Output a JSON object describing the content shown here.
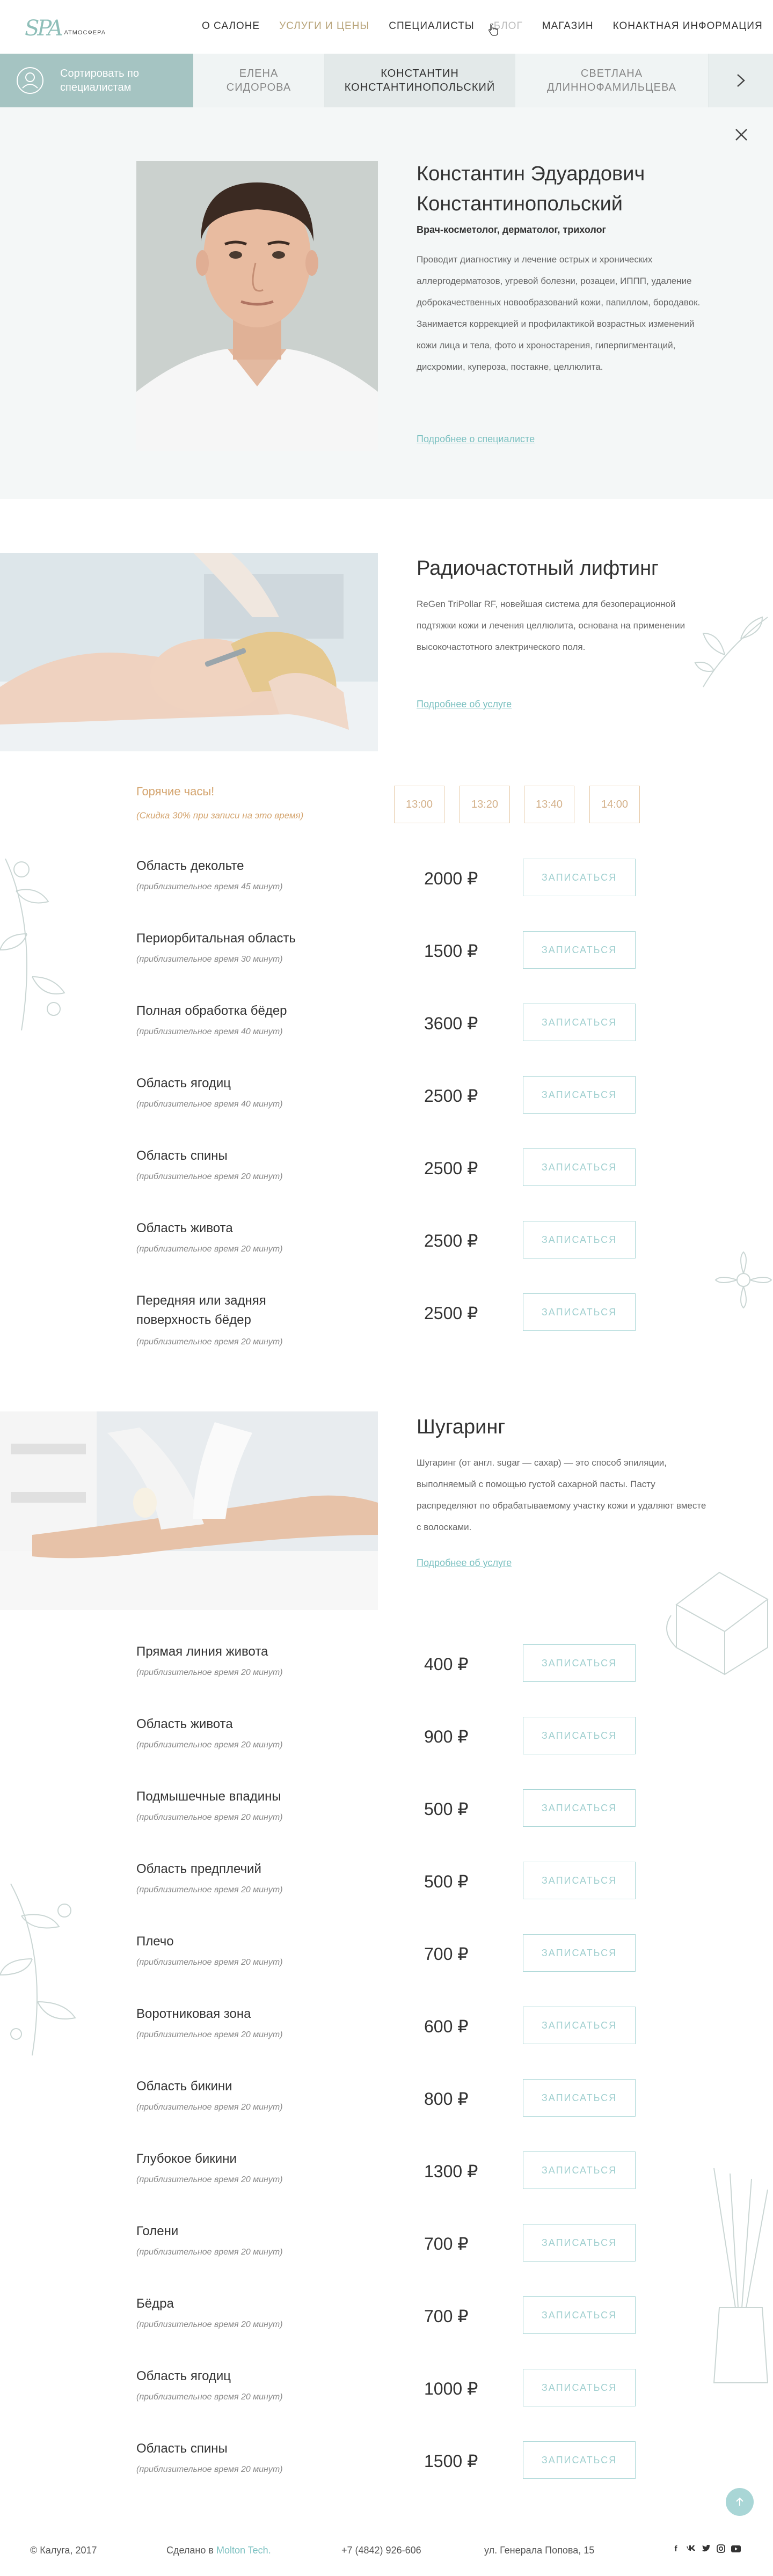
{
  "logo": {
    "mark": "SPA",
    "text": "АТМОСФЕРА"
  },
  "nav": [
    {
      "label": "О САЛОНЕ",
      "state": "normal"
    },
    {
      "label": "УСЛУГИ И ЦЕНЫ",
      "state": "active"
    },
    {
      "label": "СПЕЦИАЛИСТЫ",
      "state": "normal"
    },
    {
      "label": "БЛОГ",
      "state": "dim"
    },
    {
      "label": "МАГАЗИН",
      "state": "normal"
    },
    {
      "label": "КОНАКТНАЯ ИНФОРМАЦИЯ",
      "state": "normal"
    }
  ],
  "spec_bar": {
    "sort_label": "Сортировать по специалистам",
    "tabs": [
      "ЕЛЕНА СИДОРОВА",
      "КОНСТАНТИН КОНСТАНТИНОПОЛЬСКИЙ",
      "СВЕТЛАНА ДЛИННОФАМИЛЬЦЕВА"
    ],
    "active_tab": 1
  },
  "profile": {
    "name": "Константин Эдуардович Константинопольский",
    "role": "Врач-косметолог, дерматолог, трихолог",
    "description": "Проводит диагностику и лечение острых и хронических аллергодерматозов, угревой болезни, розацеи, ИППП, удаление доброкачественных новообразований кожи, папиллом, бородавок. Занимается коррекцией и профилактикой возрастных изменений кожи лица и тела, фото и хроностарения, гиперпигментаций, дисхромии, купероза, постакне, целлюлита.",
    "link": "Подробнее о специалисте"
  },
  "service1": {
    "title": "Радиочастотный  лифтинг",
    "description": "ReGen TriPollar RF, новейшая система для безоперационной подтяжки кожи и лечения целлюлита, основана на применении высокочастотного электрического поля.",
    "link": "Подробнее об услуге",
    "hot_title": "Горячие часы!",
    "hot_sub": "(Скидка 30% при записи на это время)",
    "slots": [
      "13:00",
      "13:20",
      "13:40",
      "14:00"
    ],
    "book_label": "ЗАПИСАТЬСЯ",
    "items": [
      {
        "name": "Область декольте",
        "time": "(приблизительное время 45 минут)",
        "price": "2000 ₽"
      },
      {
        "name": "Периорбитальная область",
        "time": "(приблизительное время 30 минут)",
        "price": "1500 ₽"
      },
      {
        "name": "Полная обработка бёдер",
        "time": "(приблизительное время 40 минут)",
        "price": "3600 ₽"
      },
      {
        "name": "Область ягодиц",
        "time": "(приблизительное время 40 минут)",
        "price": "2500 ₽"
      },
      {
        "name": "Область  спины",
        "time": "(приблизительное время 20 минут)",
        "price": "2500 ₽"
      },
      {
        "name": "Область живота",
        "time": "(приблизительное время 20 минут)",
        "price": "2500 ₽"
      },
      {
        "name": "Передняя или задняя поверхность бёдер",
        "time": "(приблизительное время 20 минут)",
        "price": "2500 ₽"
      }
    ]
  },
  "service2": {
    "title": "Шугаринг",
    "description": "Шугаринг (от англ. sugar — сахар) — это способ эпиляции, выполняемый с помощью густой сахарной пасты. Пасту распределяют по обрабатываемому участку кожи и удаляют вместе с волосками.",
    "link": "Подробнее об услуге",
    "book_label": "ЗАПИСАТЬСЯ",
    "items": [
      {
        "name": "Прямая линия живота",
        "time": "(приблизительное время 20 минут)",
        "price": "400 ₽"
      },
      {
        "name": "Область живота",
        "time": "(приблизительное время 20 минут)",
        "price": "900 ₽"
      },
      {
        "name": "Подмышечные впадины",
        "time": "(приблизительное время 20 минут)",
        "price": "500 ₽"
      },
      {
        "name": "Область предплечий",
        "time": "(приблизительное время 20 минут)",
        "price": "500 ₽"
      },
      {
        "name": "Плечо",
        "time": "(приблизительное время 20 минут)",
        "price": "700 ₽"
      },
      {
        "name": "Воротниковая зона",
        "time": "(приблизительное время 20 минут)",
        "price": "600 ₽"
      },
      {
        "name": "Область бикини",
        "time": "(приблизительное время 20 минут)",
        "price": "800 ₽"
      },
      {
        "name": "Глубокое бикини",
        "time": "(приблизительное время 20 минут)",
        "price": "1300 ₽"
      },
      {
        "name": "Голени",
        "time": "(приблизительное время 20 минут)",
        "price": "700 ₽"
      },
      {
        "name": "Бёдра",
        "time": "(приблизительное время 20 минут)",
        "price": "700 ₽"
      },
      {
        "name": "Область ягодиц",
        "time": "(приблизительное время 20 минут)",
        "price": "1000 ₽"
      },
      {
        "name": "Область спины",
        "time": "(приблизительное время 20 минут)",
        "price": "1500 ₽"
      }
    ]
  },
  "footer": {
    "copyright": "© Калуга, 2017",
    "made_by_prefix": "Сделано в",
    "made_by_brand": "Molton Tech.",
    "phone": "+7 (4842) 926-606",
    "address": "ул. Генерала Попова, 15",
    "socials": [
      "facebook-icon",
      "vk-icon",
      "twitter-icon",
      "instagram-icon",
      "youtube-icon"
    ]
  },
  "colors": {
    "accent": "#a9d6d6",
    "link": "#7ac0c0",
    "hot": "#d4a46e",
    "sort_bg": "#a5c4c2",
    "profile_bg": "#f4f7f7"
  }
}
